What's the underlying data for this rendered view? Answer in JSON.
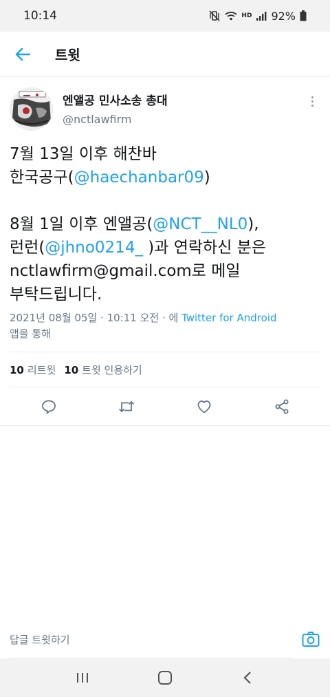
{
  "status_bar": {
    "time": "10:14",
    "hd_label": "HD",
    "battery": "92%"
  },
  "header": {
    "title": "트윗",
    "back_icon": "arrow-left-icon"
  },
  "tweet": {
    "author_name": "엔앨공 민사소송 총대",
    "author_handle": "@nctlawfirm",
    "text": {
      "l1": "7월 13일 이후 해찬바",
      "l2_prefix": "한국공구(",
      "l2_mention": "@haechanbar09",
      "l2_suffix": ")",
      "l3_prefix": "8월 1일 이후 엔앨공(",
      "l3_mention": "@NCT__NL0",
      "l3_suffix": "),",
      "l4_prefix": "런런(",
      "l4_mention": "@jhno0214_",
      "l4_suffix": " )과 연락하신 분은",
      "l5": "nctlawfirm@gmail.com로 메일",
      "l6": "부탁드립니다."
    },
    "meta_prefix": "2021년 08월 05일 · 10:11 오전 · 에 ",
    "meta_source": "Twitter for Android",
    "meta_suffix": "앱을 통해",
    "retweet_count": "10",
    "retweet_label": "리트윗",
    "quote_count": "10",
    "quote_label": "트윗 인용하기"
  },
  "actions": [
    "reply-icon",
    "retweet-icon",
    "like-icon",
    "share-icon"
  ],
  "reply_bar": {
    "placeholder": "답글 트윗하기"
  },
  "colors": {
    "accent": "#1da1f2",
    "secondary_text": "#657786",
    "primary_text": "#14171a"
  }
}
